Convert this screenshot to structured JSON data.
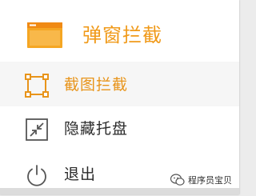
{
  "header": {
    "title": "弹窗拦截",
    "icon": "browser-window-icon"
  },
  "menu": {
    "items": [
      {
        "label": "截图拦截",
        "icon": "screenshot-crop-icon",
        "active": true
      },
      {
        "label": "隐藏托盘",
        "icon": "collapse-arrows-icon",
        "active": false
      },
      {
        "label": "退出",
        "icon": "power-icon",
        "active": false
      }
    ]
  },
  "watermark": {
    "text": "程序员宝贝",
    "icon": "wechat-icon"
  },
  "colors": {
    "accent": "#f09a1a",
    "text": "#2a2a2a",
    "icon_gray": "#555555",
    "active_bg": "#f6f6f6"
  }
}
